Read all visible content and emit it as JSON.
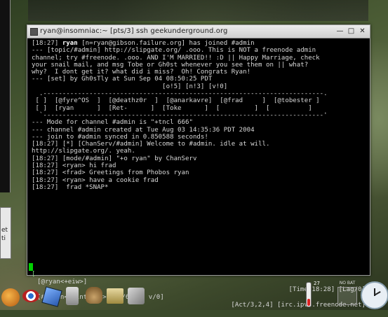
{
  "window": {
    "title": "ryan@insomniac:~ [pts/3] ssh geekunderground.org"
  },
  "left_panel": {
    "lines": [
      "et",
      "ti"
    ]
  },
  "terminal": {
    "lines": [
      {
        "t": "[18:27] ",
        "n": "ryan",
        "r": " [n=ryan@gibson.failure.org] has joined #admin"
      },
      {
        "t": "",
        "n": "",
        "r": "--- [topic/#admin] http://slipgate.org/ .ooo. This is NOT a freenode admin"
      },
      {
        "t": "",
        "n": "",
        "r": "channel; try #freenode. .ooo. AND I'M MARRIED!! :D || Happy Marriage, check"
      },
      {
        "t": "",
        "n": "",
        "r": "your snail mail, and msg Tobe or Gh0st whenever you see them on || what?"
      },
      {
        "t": "",
        "n": "",
        "r": "why?  I dont get it? what did i miss?  Oh! Congrats Ryan!"
      },
      {
        "t": "",
        "n": "",
        "r": "--- [set] by Gh0sTly at Sun Sep 04 08:50:25 PDT"
      },
      {
        "t": "",
        "n": "",
        "r": "                                  [o!5] [n!3] [v!0]"
      },
      {
        "t": "",
        "n": "",
        "r": "  .-------------------------------------------------------------------------."
      },
      {
        "t": "",
        "n": "",
        "r": " [ ]  [@fyre^OS  ]  [@deathz0r  ]  [@anarkavre]  [@frad     ]  [@tobester ]"
      },
      {
        "t": "",
        "n": "",
        "r": " [ ]  [ryan      ]  [Ret-      ]  [Toke      ]  [         ]  [          ]"
      },
      {
        "t": "",
        "n": "",
        "r": "  `-------------------------------------------------------------------------'"
      },
      {
        "t": "",
        "n": "",
        "r": "--- Mode for channel #admin is \"+tncl 666\""
      },
      {
        "t": "",
        "n": "",
        "r": "--- channel #admin created at Tue Aug 03 14:35:36 PDT 2004"
      },
      {
        "t": "",
        "n": "",
        "r": "--- join to #admin synced in 0.850588 seconds!"
      },
      {
        "t": "[18:27] ",
        "n": "",
        "r": "[*] [ChanServ/#admin] Welcome to #admin. idle at will."
      },
      {
        "t": "",
        "n": "",
        "r": "http://slipgate.org/. yeah."
      },
      {
        "t": "[18:27] ",
        "n": "",
        "r": "[mode/#admin] \"+o ryan\" by ChanServ"
      },
      {
        "t": "[18:27] ",
        "n": "",
        "r": "<ryan> hi frad"
      },
      {
        "t": "[18:27] ",
        "n": "",
        "r": "<frad> Greetings from Phobos ryan"
      },
      {
        "t": "[18:27] ",
        "n": "",
        "r": "<ryan> have a cookie frad"
      },
      {
        "t": "[18:27] ",
        "n": "",
        "r": " frad *SNAP*"
      }
    ]
  },
  "statusbar": {
    "row1_left": "[@ryan<+eiw>]",
    "row1_right": "[Time/18:28] [Lag/0]",
    "row2_left": "[#admin<+clnt 666>] [o/6 n/2 v/0]",
    "row2_right": "[Act/3,2,4] [irc.ipv6.freenode.net]"
  },
  "tray": {
    "temperature": "27",
    "battery": "NO BAT"
  }
}
